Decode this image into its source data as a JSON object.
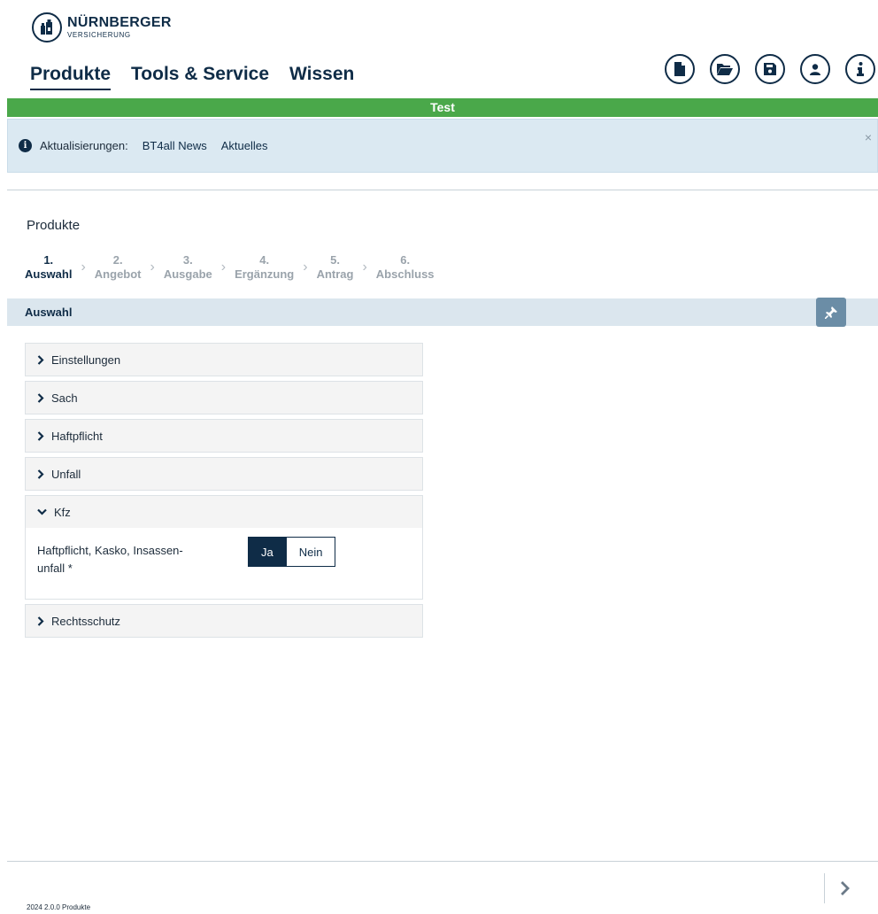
{
  "brand": {
    "name": "NÜRNBERGER",
    "sub": "VERSICHERUNG"
  },
  "mainnav": [
    {
      "label": "Produkte",
      "active": true
    },
    {
      "label": "Tools & Service",
      "active": false
    },
    {
      "label": "Wissen",
      "active": false
    }
  ],
  "header_icons": [
    "new-document-icon",
    "open-folder-icon",
    "save-icon",
    "user-icon",
    "info-icon"
  ],
  "env_banner": "Test",
  "info_bar": {
    "label": "Aktualisierungen:",
    "links": [
      "BT4all News",
      "Aktuelles"
    ],
    "close": "×"
  },
  "page_title": "Produkte",
  "stepper": [
    {
      "num": "1.",
      "label": "Auswahl",
      "active": true
    },
    {
      "num": "2.",
      "label": "Angebot",
      "active": false
    },
    {
      "num": "3.",
      "label": "Ausgabe",
      "active": false
    },
    {
      "num": "4.",
      "label": "Ergänzung",
      "active": false
    },
    {
      "num": "5.",
      "label": "Antrag",
      "active": false
    },
    {
      "num": "6.",
      "label": "Abschluss",
      "active": false
    }
  ],
  "section_title": "Auswahl",
  "accordion": [
    {
      "label": "Einstellungen",
      "open": false
    },
    {
      "label": "Sach",
      "open": false
    },
    {
      "label": "Haftpflicht",
      "open": false
    },
    {
      "label": "Unfall",
      "open": false
    },
    {
      "label": "Kfz",
      "open": true
    },
    {
      "label": "Rechtsschutz",
      "open": false
    }
  ],
  "kfz": {
    "field_label_line1": "Haftpflicht, Kasko, Insassen-",
    "field_label_line2": "unfall *",
    "yes": "Ja",
    "no": "Nein",
    "selected": "Ja"
  },
  "footer": {
    "version": "2024 2.0.0 Produkte"
  },
  "colors": {
    "primary": "#0f2c47",
    "banner": "#4aa84a",
    "info_bg": "#dbe9f2",
    "pin": "#6b8da6"
  }
}
